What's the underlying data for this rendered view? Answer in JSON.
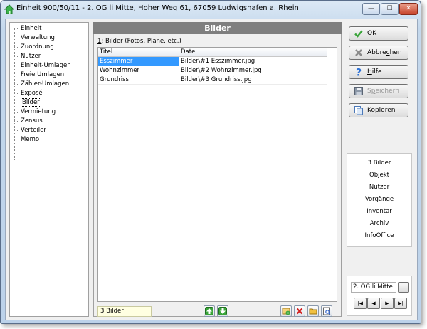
{
  "window": {
    "title": "Einheit 900/50/11 - 2. OG li Mitte, Hoher Weg 61, 67059 Ludwigshafen a. Rhein",
    "controls": {
      "minimize": "—",
      "maximize": "☐",
      "close": "✕"
    }
  },
  "tree": {
    "items": [
      {
        "label": "Einheit",
        "selected": false
      },
      {
        "label": "Verwaltung",
        "selected": false
      },
      {
        "label": "Zuordnung",
        "selected": false
      },
      {
        "label": "Nutzer",
        "selected": false
      },
      {
        "label": "Einheit-Umlagen",
        "selected": false
      },
      {
        "label": "Freie Umlagen",
        "selected": false
      },
      {
        "label": "Zähler-Umlagen",
        "selected": false
      },
      {
        "label": "Exposé",
        "selected": false
      },
      {
        "label": "Bilder",
        "selected": true
      },
      {
        "label": "Vermietung",
        "selected": false
      },
      {
        "label": "Zensus",
        "selected": false
      },
      {
        "label": "Verteiler",
        "selected": false
      },
      {
        "label": "Memo",
        "selected": false
      }
    ]
  },
  "panel": {
    "header": "Bilder",
    "group_mnemonic": "1",
    "group_label": ": Bilder (Fotos, Pläne, etc.)",
    "columns": [
      "Titel",
      "Datei"
    ],
    "rows": [
      {
        "titel": "Esszimmer",
        "datei": "Bilder\\#1 Esszimmer.jpg",
        "selected": true
      },
      {
        "titel": "Wohnzimmer",
        "datei": "Bilder\\#2 Wohnzimmer.jpg",
        "selected": false
      },
      {
        "titel": "Grundriss",
        "datei": "Bilder\\#3 Grundriss.jpg",
        "selected": false
      }
    ],
    "count": "3 Bilder"
  },
  "buttons": {
    "ok": "OK",
    "cancel_pre": "Abbre",
    "cancel_mn": "c",
    "cancel_post": "hen",
    "help_mn": "H",
    "help_post": "ilfe",
    "save_pre": "S",
    "save_mn": "p",
    "save_post": "eichern",
    "copy": "Kopieren"
  },
  "quicklinks": [
    "3 Bilder",
    "Objekt",
    "Nutzer",
    "Vorgänge",
    "Inventar",
    "Archiv",
    "InfoOffice"
  ],
  "navigator": {
    "current": "2. OG li Mitte",
    "more": "...",
    "first": "|◀",
    "prev": "◀",
    "next": "▶",
    "last": "▶|"
  },
  "colors": {
    "header_bg": "#7f7f7f",
    "selection": "#3399ff",
    "count_bg": "#ffffe1",
    "arrow_green": "#3aa53a"
  },
  "icons": {
    "app": "house-green-icon",
    "ok": "checkmark-icon",
    "cancel": "cross-icon",
    "help": "question-icon",
    "save": "floppy-disk-icon",
    "copy": "copy-icon",
    "move_up": "arrow-up-icon",
    "move_down": "arrow-down-icon",
    "add": "add-image-icon",
    "delete": "delete-icon",
    "open": "folder-icon",
    "preview": "preview-icon"
  }
}
